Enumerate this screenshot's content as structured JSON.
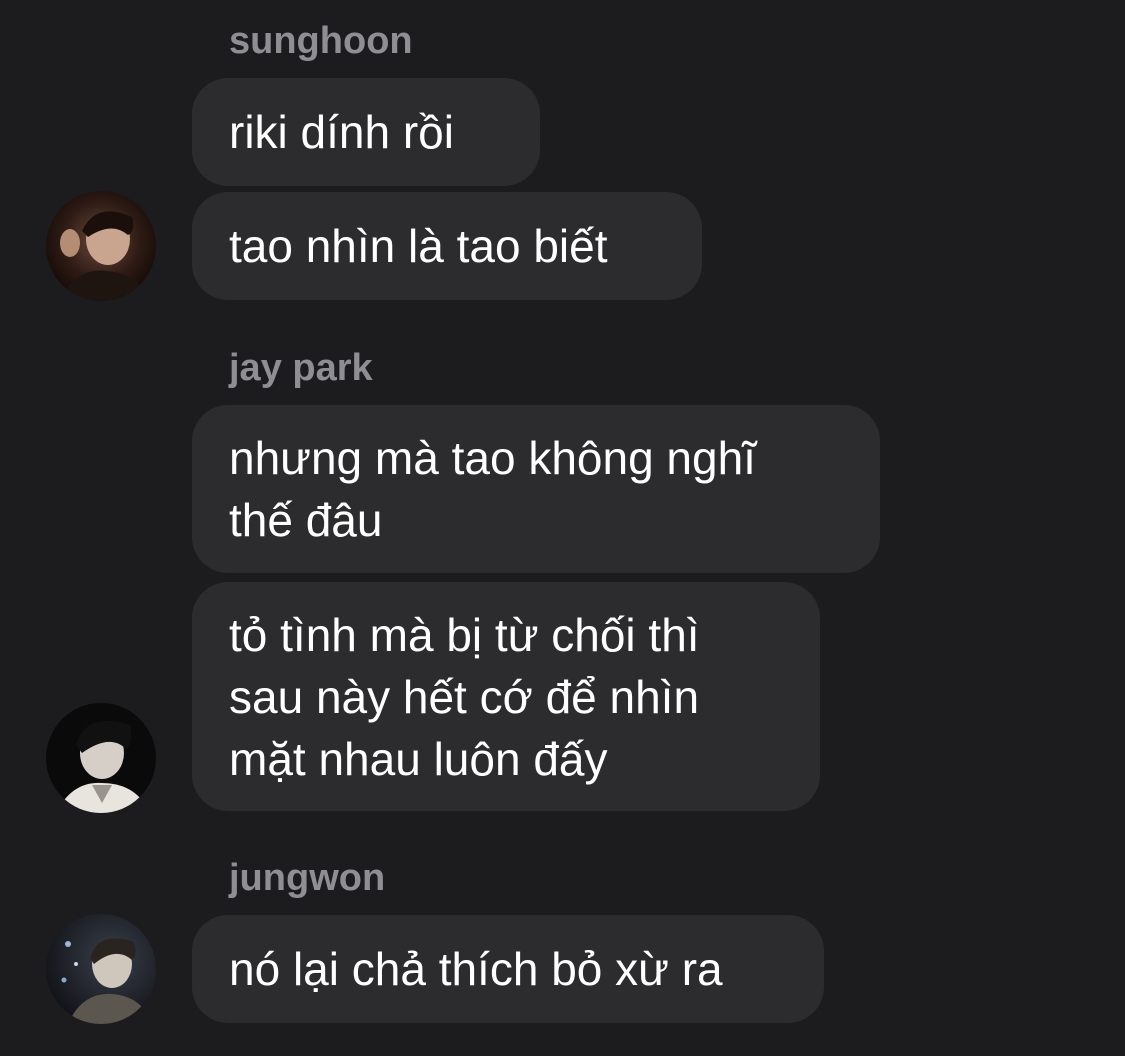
{
  "messages_groups": [
    {
      "sender": "sunghoon",
      "messages": [
        "riki dính rồi",
        "tao nhìn là tao biết"
      ],
      "avatar_icon": "user-avatar-icon"
    },
    {
      "sender": "jay park",
      "messages": [
        "nhưng mà tao không nghĩ\nthế đâu",
        "tỏ tình mà bị từ chối thì\nsau này hết cớ để nhìn\nmặt nhau luôn đấy"
      ],
      "avatar_icon": "user-avatar-icon"
    },
    {
      "sender": "jungwon",
      "messages": [
        "nó lại chả thích bỏ xừ ra"
      ],
      "avatar_icon": "user-avatar-icon"
    }
  ],
  "colors": {
    "background": "#1c1c1e",
    "bubble": "#2c2c2e",
    "sender_name": "#8e8e93",
    "message_text": "#ffffff"
  }
}
